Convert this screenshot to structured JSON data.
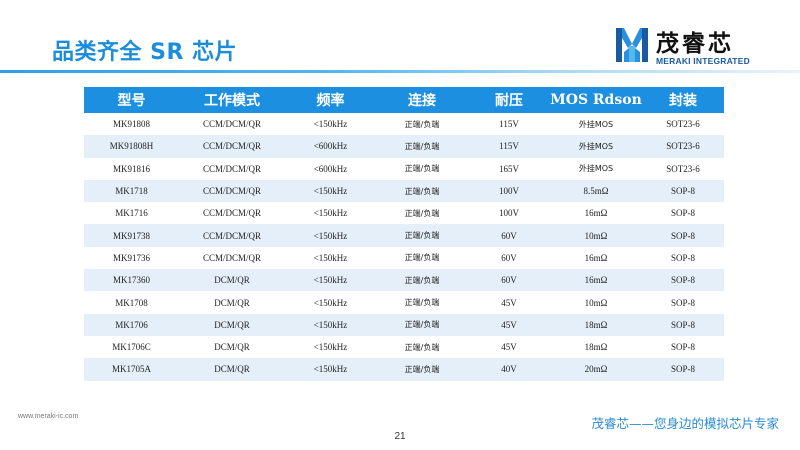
{
  "slide": {
    "title": "品类齐全 SR 芯片",
    "page_number": "21"
  },
  "logo": {
    "name_cn": "茂睿芯",
    "name_en": "MERAKI INTEGRATED"
  },
  "table": {
    "headers": [
      "型号",
      "工作模式",
      "频率",
      "连接",
      "耐压",
      "MOS Rdson",
      "封装"
    ],
    "rows": [
      [
        "MK91808",
        "CCM/DCM/QR",
        "<150kHz",
        "正端/负端",
        "115V",
        "外挂MOS",
        "SOT23-6"
      ],
      [
        "MK91808H",
        "CCM/DCM/QR",
        "<600kHz",
        "正端/负端",
        "115V",
        "外挂MOS",
        "SOT23-6"
      ],
      [
        "MK91816",
        "CCM/DCM/QR",
        "<600kHz",
        "正端/负端",
        "165V",
        "外挂MOS",
        "SOT23-6"
      ],
      [
        "MK1718",
        "CCM/DCM/QR",
        "<150kHz",
        "正端/负端",
        "100V",
        "8.5mΩ",
        "SOP-8"
      ],
      [
        "MK1716",
        "CCM/DCM/QR",
        "<150kHz",
        "正端/负端",
        "100V",
        "16mΩ",
        "SOP-8"
      ],
      [
        "MK91738",
        "CCM/DCM/QR",
        "<150kHz",
        "正端/负端",
        "60V",
        "10mΩ",
        "SOP-8"
      ],
      [
        "MK91736",
        "CCM/DCM/QR",
        "<150kHz",
        "正端/负端",
        "60V",
        "16mΩ",
        "SOP-8"
      ],
      [
        "MK17360",
        "DCM/QR",
        "<150kHz",
        "正端/负端",
        "60V",
        "16mΩ",
        "SOP-8"
      ],
      [
        "MK1708",
        "DCM/QR",
        "<150kHz",
        "正端/负端",
        "45V",
        "10mΩ",
        "SOP-8"
      ],
      [
        "MK1706",
        "DCM/QR",
        "<150kHz",
        "正端/负端",
        "45V",
        "18mΩ",
        "SOP-8"
      ],
      [
        "MK1706C",
        "DCM/QR",
        "<150kHz",
        "正端/负端",
        "45V",
        "18mΩ",
        "SOP-8"
      ],
      [
        "MK1705A",
        "DCM/QR",
        "<150kHz",
        "正端/负端",
        "40V",
        "20mΩ",
        "SOP-8"
      ]
    ]
  },
  "footer": {
    "url": "www.meraki-ic.com",
    "slogan": "茂睿芯——您身边的模拟芯片专家"
  },
  "colors": {
    "accent": "#1d8fe0",
    "title": "#1c8ddb",
    "row_stripe": "#e4eff9",
    "slogan": "#2a8bd4"
  }
}
